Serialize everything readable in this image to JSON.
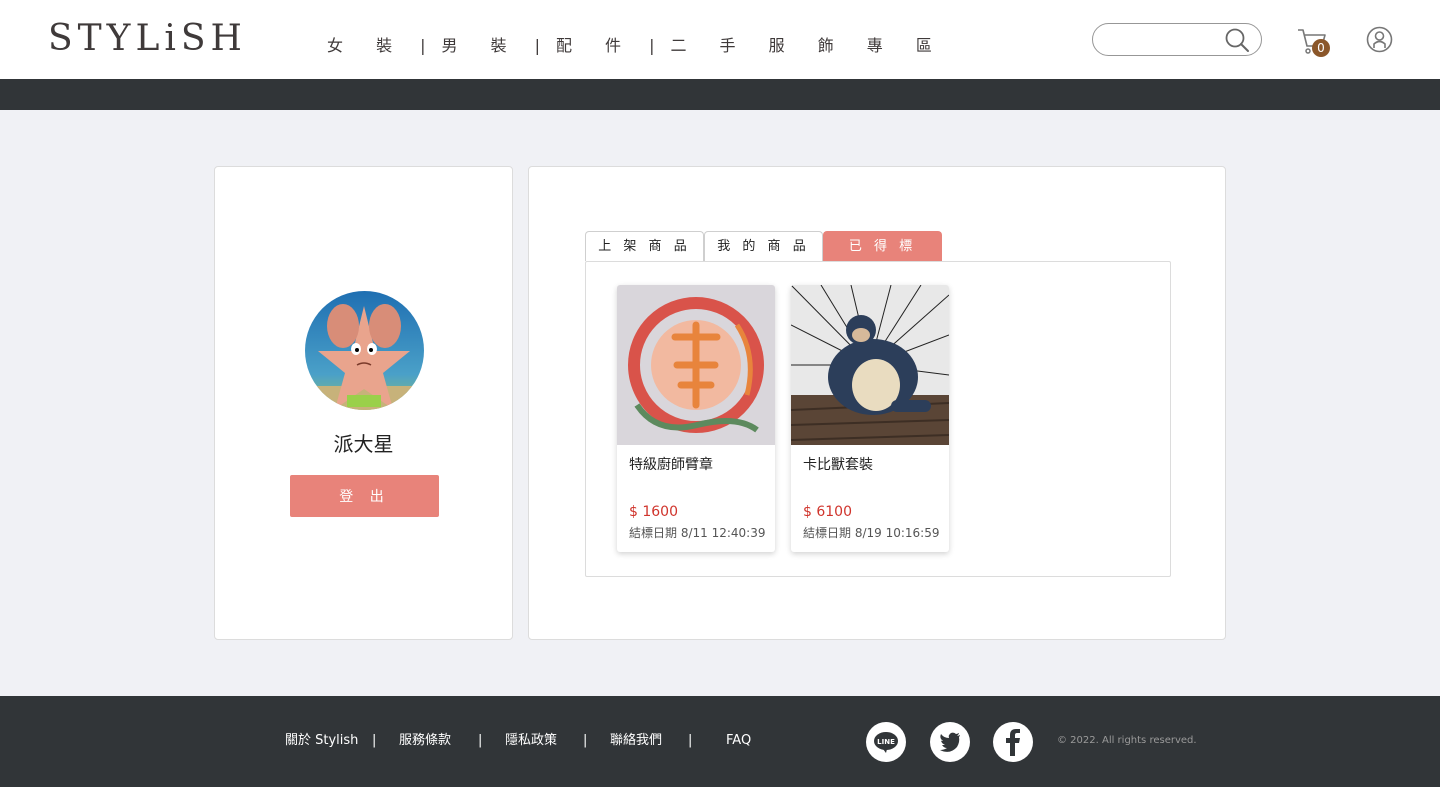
{
  "header": {
    "logo": "STYLiSH",
    "nav": [
      "女 裝",
      "男 裝",
      "配 件",
      "二 手 服 飾 專 區"
    ],
    "nav_separator": "|",
    "search_placeholder": "",
    "cart_count": "0"
  },
  "profile": {
    "name": "派大星",
    "logout_label": "登 出"
  },
  "tabs": [
    "上 架 商 品",
    "我 的 商 品",
    "已 得 標"
  ],
  "active_tab": 2,
  "products": [
    {
      "name": "特級廚師臂章",
      "price": "$ 1600",
      "date": "結標日期 8/11 12:40:39"
    },
    {
      "name": "卡比獸套裝",
      "price": "$ 6100",
      "date": "結標日期 8/19 10:16:59"
    }
  ],
  "footer": {
    "links": [
      "關於 Stylish",
      "服務條款",
      "隱私政策",
      "聯絡我們",
      "FAQ"
    ],
    "separator": "|",
    "social": [
      "line-icon",
      "twitter-icon",
      "facebook-icon"
    ],
    "line_text": "LINE",
    "copyright": "© 2022. All rights reserved."
  },
  "colors": {
    "accent": "#e8837a",
    "dark": "#313538",
    "price": "#d0342c",
    "badge": "#8b572a"
  }
}
